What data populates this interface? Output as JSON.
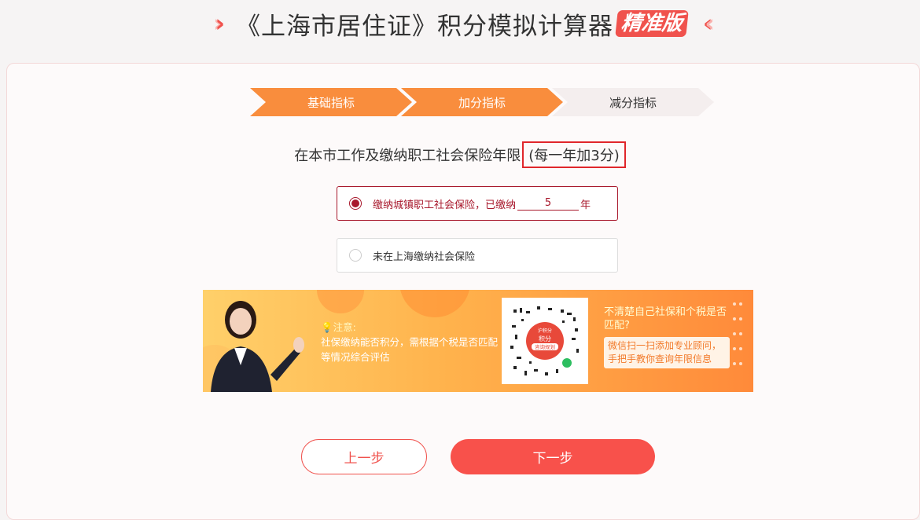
{
  "header": {
    "title": "《上海市居住证》积分模拟计算器",
    "badge": "精准版"
  },
  "steps": [
    {
      "label": "基础指标",
      "active": true
    },
    {
      "label": "加分指标",
      "active": true
    },
    {
      "label": "减分指标",
      "active": false
    }
  ],
  "question": {
    "text": "在本市工作及缴纳职工社会保险年限",
    "hint": "(每一年加3分)"
  },
  "options": {
    "paid": {
      "prefix": "缴纳城镇职工社会保险，已缴纳",
      "years": "5",
      "suffix": "年",
      "selected": true
    },
    "unpaid": {
      "label": "未在上海缴纳社会保险",
      "selected": false
    }
  },
  "banner": {
    "notice_head": "注意:",
    "notice_body": "社保缴纳能否积分，需根据个税是否匹配等情况综合评估",
    "qr_top": "沪积分",
    "qr_mid": "积分",
    "qr_bottom": "咨询规划",
    "right_title": "不清楚自己社保和个税是否匹配?",
    "right_body": "微信扫一扫添加专业顾问，手把手教你查询年限信息"
  },
  "buttons": {
    "prev": "上一步",
    "next": "下一步"
  },
  "colors": {
    "accent": "#f0524d",
    "step_active": "#f98d3d",
    "selected": "#a8182c",
    "highlight_box": "#e0262b"
  }
}
